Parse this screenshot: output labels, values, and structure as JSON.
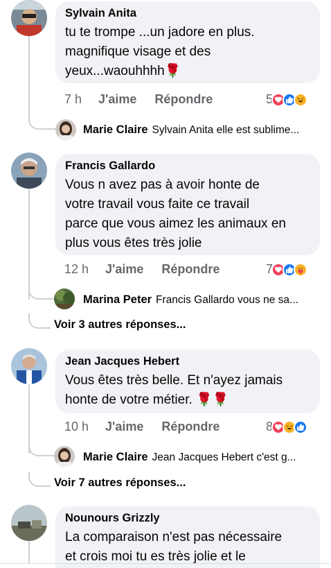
{
  "comments": [
    {
      "author": "Sylvain Anita",
      "lines": [
        "tu te trompe ...un jadore en plus.",
        "magnifique visage et des",
        "yeux...waouhhhh🌹"
      ],
      "time": "7 h",
      "like": "J'aime",
      "reply": "Répondre",
      "reaction_count": "5",
      "reactions": [
        "love",
        "like",
        "haha"
      ],
      "replies": [
        {
          "name": "Marie Claire",
          "text": "Sylvain Anita elle est sublime..."
        }
      ],
      "more": ""
    },
    {
      "author": "Francis Gallardo",
      "lines": [
        "Vous n avez pas à avoir honte de",
        "votre travail vous faite ce travail",
        "parce que vous aimez les animaux en",
        "plus vous êtes très jolie"
      ],
      "time": "12 h",
      "like": "J'aime",
      "reply": "Répondre",
      "reaction_count": "7",
      "reactions": [
        "love",
        "like",
        "care"
      ],
      "replies": [
        {
          "name": "Marina Peter",
          "text": "Francis Gallardo vous ne sa..."
        }
      ],
      "more": "Voir 3 autres réponses..."
    },
    {
      "author": "Jean Jacques Hebert",
      "lines": [
        "Vous êtes très belle. Et n'ayez jamais",
        "honte de votre métier. 🌹🌹"
      ],
      "time": "10 h",
      "like": "J'aime",
      "reply": "Répondre",
      "reaction_count": "8",
      "reactions": [
        "love",
        "haha",
        "like"
      ],
      "replies": [
        {
          "name": "Marie Claire",
          "text": "Jean Jacques Hebert c'est g..."
        }
      ],
      "more": "Voir 7 autres réponses..."
    },
    {
      "author": "Nounours Grizzly",
      "lines": [
        "La comparaison n'est pas  nécessaire",
        "et crois moi tu es très jolie et le"
      ]
    }
  ],
  "colors": {
    "bubble_bg": "#f0f2f5",
    "meta_text": "#65676b",
    "love": "#f33e58",
    "like": "#1877f2",
    "haha": "#f7b125"
  }
}
